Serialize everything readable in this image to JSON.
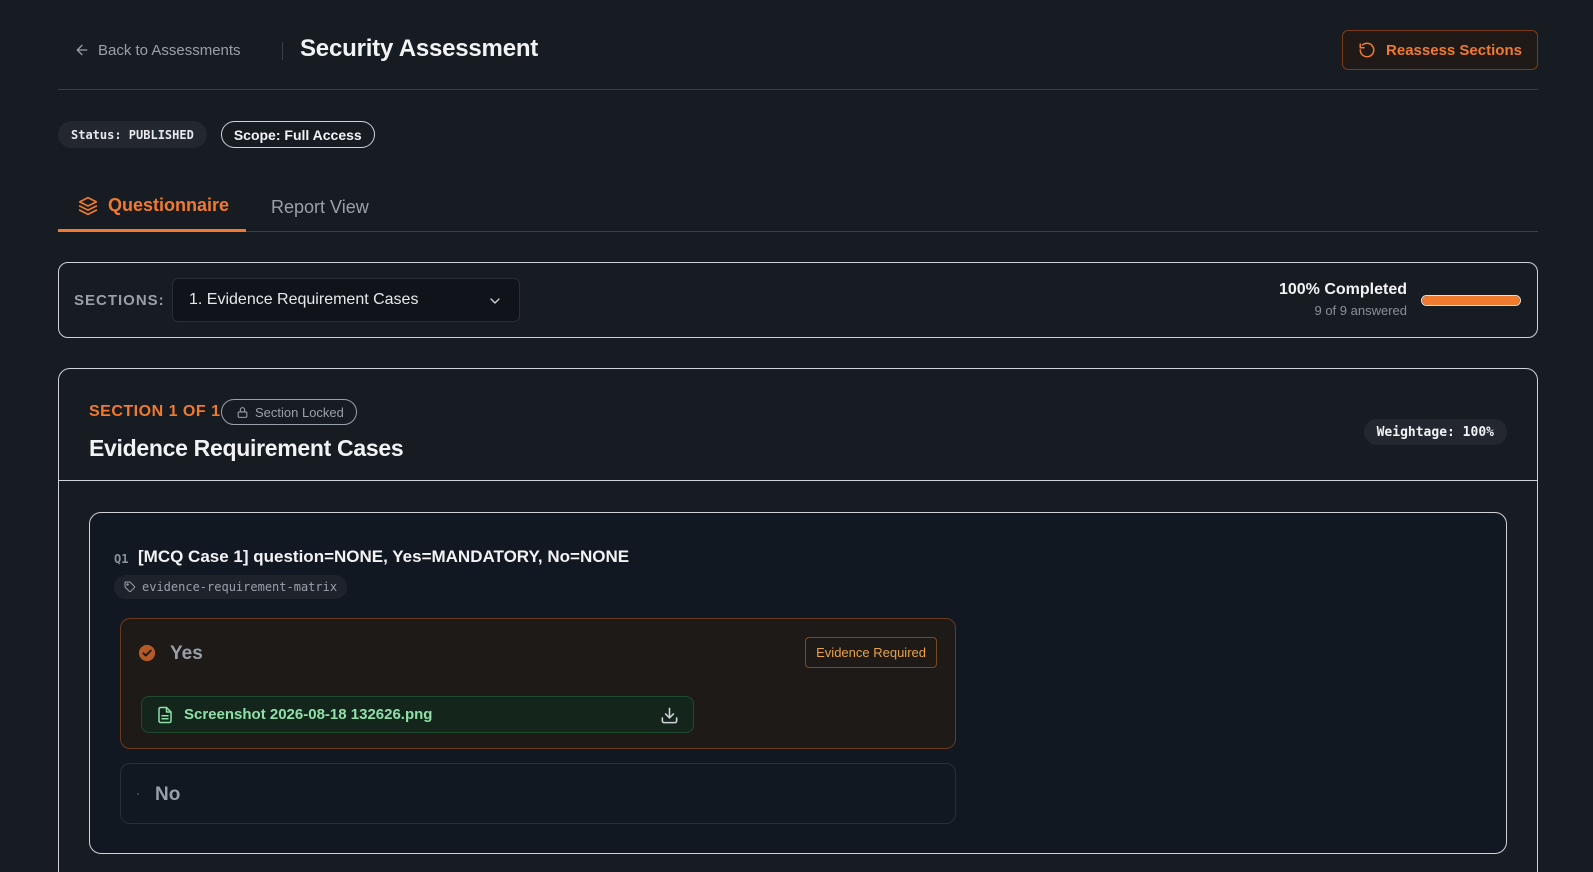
{
  "header": {
    "back_label": "Back to Assessments",
    "title": "Security Assessment",
    "reassess_label": "Reassess Sections"
  },
  "badges": {
    "status": "Status: PUBLISHED",
    "scope": "Scope: Full Access"
  },
  "tabs": [
    {
      "label": "Questionnaire",
      "active": true,
      "icon": "layers-icon"
    },
    {
      "label": "Report View",
      "active": false
    }
  ],
  "sections_bar": {
    "label": "SECTIONS:",
    "selected": "1. Evidence Requirement Cases",
    "progress_label": "100% Completed",
    "progress_value": 1.0,
    "answered": "9 of 9 answered"
  },
  "section": {
    "kicker": "SECTION 1 OF 1",
    "locked_label": "Section Locked",
    "title": "Evidence Requirement Cases",
    "weightage": "Weightage: 100%"
  },
  "question": {
    "number": "Q1",
    "text": "[MCQ Case 1] question=NONE, Yes=MANDATORY, No=NONE",
    "tag": "evidence-requirement-matrix",
    "options": [
      {
        "label": "Yes",
        "selected": true,
        "badge": "Evidence Required",
        "file": "Screenshot 2026-08-18 132626.png"
      },
      {
        "label": "No",
        "selected": false
      }
    ]
  },
  "colors": {
    "accent": "#f07a2e",
    "background": "#171b22",
    "success": "#8fe0a8",
    "warning": "#e8a24a"
  }
}
